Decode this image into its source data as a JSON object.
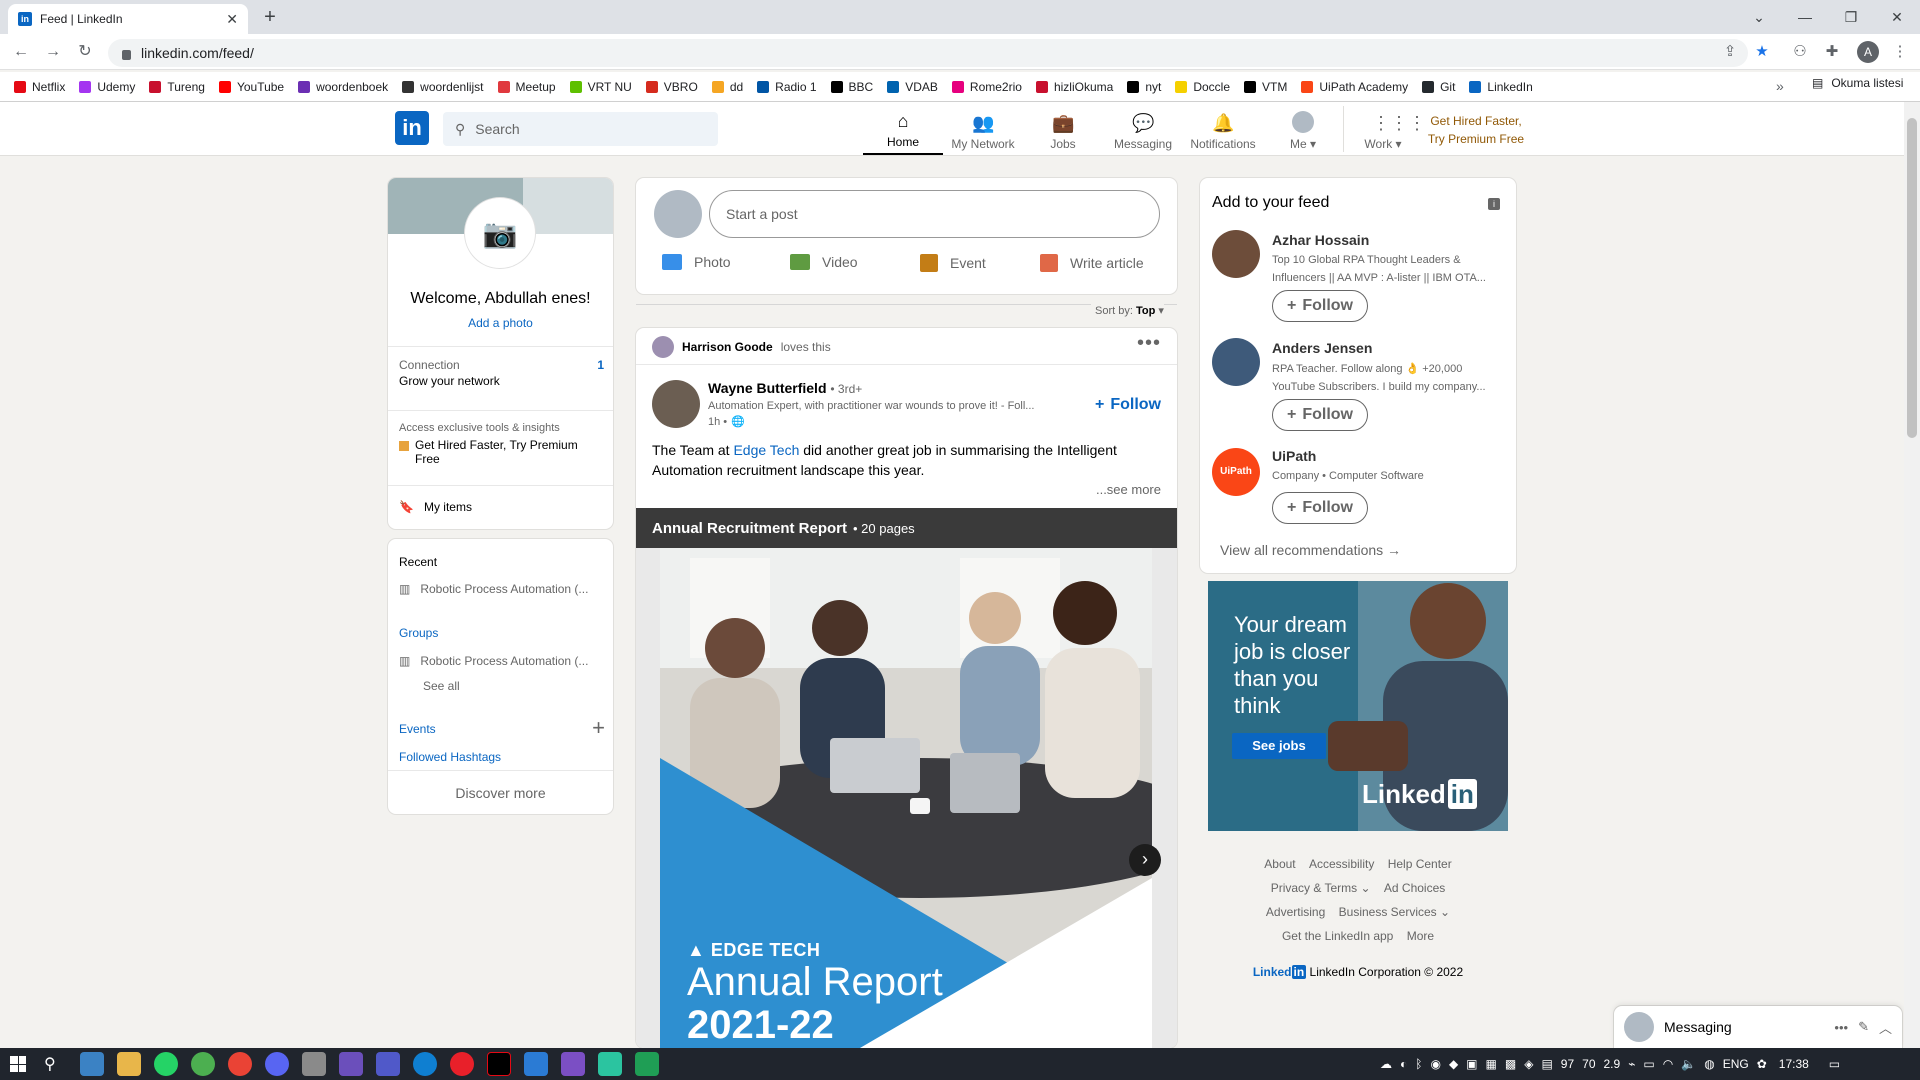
{
  "browser": {
    "tab_title": "Feed | LinkedIn",
    "url": "linkedin.com/feed/",
    "profile_initial": "A",
    "bookmarks": [
      {
        "label": "Netflix",
        "color": "#e50914"
      },
      {
        "label": "Udemy",
        "color": "#a435f0"
      },
      {
        "label": "Tureng",
        "color": "#c8102e"
      },
      {
        "label": "YouTube",
        "color": "#ff0000"
      },
      {
        "label": "woordenboek",
        "color": "#6b2fb3"
      },
      {
        "label": "woordenlijst",
        "color": "#333333"
      },
      {
        "label": "Meetup",
        "color": "#e0393e"
      },
      {
        "label": "VRT NU",
        "color": "#5ec000"
      },
      {
        "label": "VBRO",
        "color": "#d52b1e"
      },
      {
        "label": "dd",
        "color": "#f5a623"
      },
      {
        "label": "Radio 1",
        "color": "#0055a5"
      },
      {
        "label": "BBC",
        "color": "#000000"
      },
      {
        "label": "VDAB",
        "color": "#0063af"
      },
      {
        "label": "Rome2rio",
        "color": "#e6007e"
      },
      {
        "label": "hizliOkuma",
        "color": "#c8102e"
      },
      {
        "label": "nyt",
        "color": "#000000"
      },
      {
        "label": "Doccle",
        "color": "#f5d000"
      },
      {
        "label": "VTM",
        "color": "#000000"
      },
      {
        "label": "UiPath Academy",
        "color": "#fa4616"
      },
      {
        "label": "Git",
        "color": "#24292e"
      },
      {
        "label": "LinkedIn",
        "color": "#0a66c2"
      }
    ],
    "bookmarks_more": "»",
    "reading_list": "Okuma listesi"
  },
  "header": {
    "logo": "in",
    "search_placeholder": "Search",
    "nav": [
      {
        "label": "Home",
        "icon": "home-icon"
      },
      {
        "label": "My Network",
        "icon": "network-icon"
      },
      {
        "label": "Jobs",
        "icon": "briefcase-icon"
      },
      {
        "label": "Messaging",
        "icon": "chat-icon"
      },
      {
        "label": "Notifications",
        "icon": "bell-icon"
      },
      {
        "label": "Me",
        "icon": "avatar"
      },
      {
        "label": "Work",
        "icon": "grid-icon"
      }
    ],
    "premium_line1": "Get Hired Faster,",
    "premium_line2": "Try Premium Free"
  },
  "profile": {
    "welcome": "Welcome, Abdullah enes!",
    "add_photo": "Add a photo",
    "connection_label": "Connection",
    "connection_sub": "Grow your network",
    "connection_count": "1",
    "premium_teaser": "Access exclusive tools & insights",
    "premium_link": "Get Hired Faster, Try Premium Free",
    "my_items": "My items"
  },
  "sidebar": {
    "recent_title": "Recent",
    "recent_item": "Robotic Process Automation (...",
    "groups_title": "Groups",
    "groups_item": "Robotic Process Automation (...",
    "see_all": "See all",
    "events": "Events",
    "hashtags": "Followed Hashtags",
    "discover": "Discover more"
  },
  "compose": {
    "placeholder": "Start a post",
    "actions": [
      {
        "label": "Photo",
        "color": "#378fe9"
      },
      {
        "label": "Video",
        "color": "#5f9b41"
      },
      {
        "label": "Event",
        "color": "#c37d16"
      },
      {
        "label": "Write article",
        "color": "#e06847"
      }
    ]
  },
  "sort": {
    "label": "Sort by:",
    "value": "Top"
  },
  "post": {
    "activity_actor": "Harrison Goode",
    "activity_verb": "loves this",
    "author": "Wayne Butterfield",
    "degree": "• 3rd+",
    "headline": "Automation Expert, with practitioner war wounds to prove it! - Foll...",
    "time": "1h •",
    "follow": "Follow",
    "text_before": "The Team at ",
    "text_link": "Edge Tech",
    "text_after": " did another great job in summarising the Intelligent Automation recruitment landscape this year.",
    "see_more": "...see more",
    "doc_title": "Annual Recruitment Report",
    "doc_pages": "• 20 pages",
    "brand": "EDGE TECH",
    "report_title": "Annual Report",
    "report_year": "2021-22"
  },
  "feed_suggestions": {
    "title": "Add to your feed",
    "follow_label": "Follow",
    "people": [
      {
        "name": "Azhar Hossain",
        "desc1": "Top 10 Global RPA Thought Leaders &",
        "desc2": "Influencers || AA MVP : A-lister || IBM OTA..."
      },
      {
        "name": "Anders Jensen",
        "desc1": "RPA Teacher. Follow along 👌 +20,000",
        "desc2": "YouTube Subscribers. I build my company..."
      },
      {
        "name": "UiPath",
        "desc1": "Company • Computer Software",
        "desc2": ""
      }
    ],
    "uipath_logo": "UiPath",
    "view_all": "View all recommendations →"
  },
  "ad": {
    "line1": "Your dream",
    "line2": "job is closer",
    "line3": "than you",
    "line4": "think",
    "cta": "See jobs",
    "brand": "Linked",
    "brand_in": "in"
  },
  "footer": {
    "row1": [
      "About",
      "Accessibility",
      "Help Center"
    ],
    "row2": [
      "Privacy & Terms ⌄",
      "Ad Choices"
    ],
    "row3": [
      "Advertising",
      "Business Services ⌄"
    ],
    "row4": [
      "Get the LinkedIn app",
      "More"
    ],
    "brand": "Linked",
    "brand_in": "in",
    "copyright": "LinkedIn Corporation © 2022"
  },
  "messaging": {
    "label": "Messaging"
  },
  "taskbar": {
    "time": "17:38",
    "lang": "ENG",
    "tray_nums": [
      "97",
      "70",
      "2.9"
    ]
  }
}
